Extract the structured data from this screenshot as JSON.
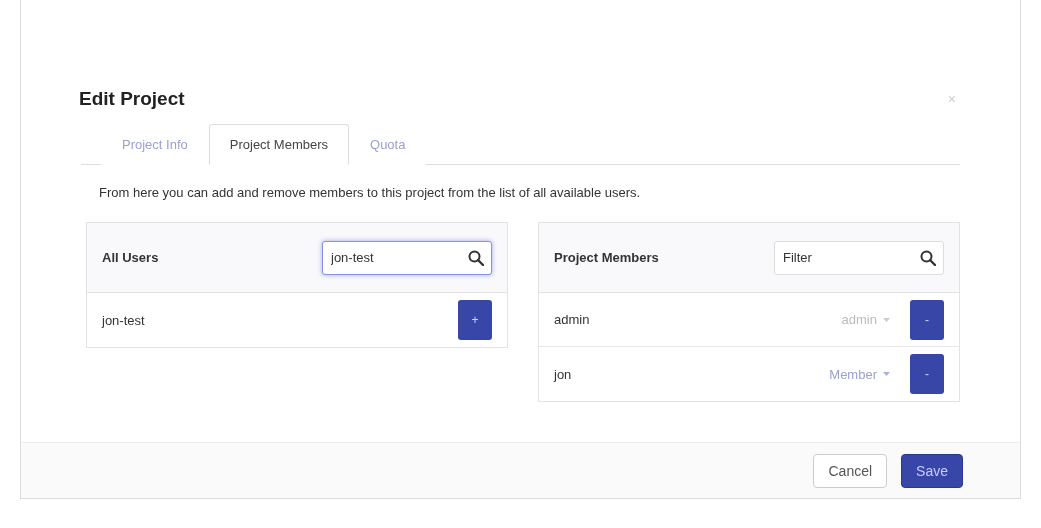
{
  "dialog": {
    "title": "Edit Project",
    "close": "×"
  },
  "tabs": [
    {
      "label": "Project Info",
      "selected": false
    },
    {
      "label": "Project Members",
      "selected": true
    },
    {
      "label": "Quota",
      "selected": false
    }
  ],
  "description": "From here you can add and remove members to this project from the list of all available users.",
  "all_users": {
    "title": "All Users",
    "search": {
      "value": "jon-test",
      "focused": true
    },
    "rows": [
      {
        "name": "jon-test",
        "action": "+"
      }
    ]
  },
  "project_members": {
    "title": "Project Members",
    "search": {
      "placeholder": "Filter",
      "focused": false
    },
    "rows": [
      {
        "name": "admin",
        "role": "admin",
        "disabled": true,
        "action": "-"
      },
      {
        "name": "jon",
        "role": "Member",
        "disabled": false,
        "action": "-"
      }
    ]
  },
  "buttons": [
    {
      "label": "Cancel",
      "kind": "secondary"
    },
    {
      "label": "Save",
      "kind": "primary"
    }
  ]
}
